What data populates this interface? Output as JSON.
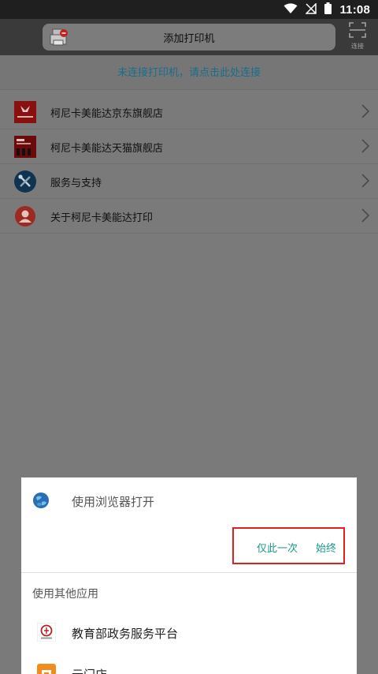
{
  "status_bar": {
    "time": "11:08",
    "icons": [
      "wifi-icon",
      "no-signal-icon",
      "battery-icon"
    ]
  },
  "header": {
    "add_printer_label": "添加打印机",
    "scan_label": "连接"
  },
  "connect_banner": {
    "text": "未连接打印机，请点击此处连接"
  },
  "menu": {
    "items": [
      {
        "label": "柯尼卡美能达京东旗舰店",
        "icon": "jd-store-logo"
      },
      {
        "label": "柯尼卡美能达天猫旗舰店",
        "icon": "tmall-store-logo"
      },
      {
        "label": "服务与支持",
        "icon": "tools-icon"
      },
      {
        "label": "关于柯尼卡美能达打印",
        "icon": "user-icon"
      }
    ]
  },
  "dialog": {
    "browser_title": "使用浏览器打开",
    "once_label": "仅此一次",
    "always_label": "始终",
    "other_apps_title": "使用其他应用",
    "apps": [
      {
        "label": "教育部政务服务平台",
        "icon": "moe-app-icon"
      },
      {
        "label": "云门店",
        "icon": "yunmendian-app-icon"
      }
    ]
  },
  "colors": {
    "accent_teal": "#1a9a8a",
    "banner_link": "#1a6d8c",
    "highlight_red": "#e02020"
  }
}
